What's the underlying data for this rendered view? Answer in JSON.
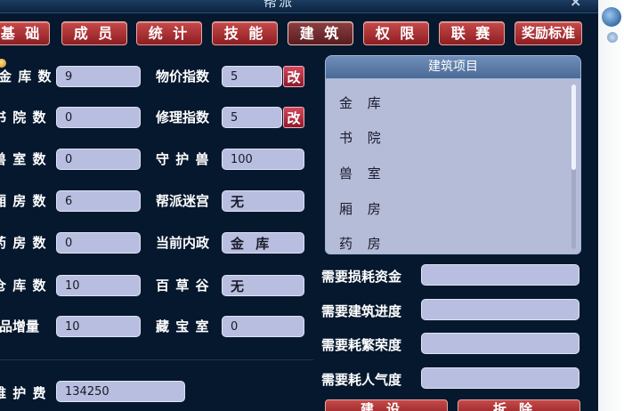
{
  "window": {
    "title": "帮派",
    "close": "×"
  },
  "tabs": [
    "基 础",
    "成 员",
    "统 计",
    "技 能",
    "建 筑",
    "权 限",
    "联 赛",
    "奖励标准"
  ],
  "left_col": [
    {
      "label": "金 库 数",
      "value": "9"
    },
    {
      "label": "书 院 数",
      "value": "0"
    },
    {
      "label": "兽 室 数",
      "value": "0"
    },
    {
      "label": "厢 房 数",
      "value": "6"
    },
    {
      "label": "药 房 数",
      "value": "0"
    },
    {
      "label": "仓 库 数",
      "value": "10"
    },
    {
      "label": "药品增量",
      "value": "10"
    }
  ],
  "mid_col": [
    {
      "label": "物价指数",
      "value": "5",
      "button": "改"
    },
    {
      "label": "修理指数",
      "value": "5",
      "button": "改"
    },
    {
      "label": "守 护 兽",
      "value": "100"
    },
    {
      "label": "帮派迷宫",
      "value": "无"
    },
    {
      "label": "当前内政",
      "value": "金 库"
    },
    {
      "label": "百 草 谷",
      "value": "无"
    },
    {
      "label": "藏 宝 室",
      "value": "0"
    }
  ],
  "maintenance": {
    "label": "维 护 费",
    "value": "134250"
  },
  "building_panel": {
    "title": "建筑项目",
    "items": [
      "金 库",
      "书 院",
      "兽 室",
      "厢 房",
      "药 房"
    ]
  },
  "requirements": [
    {
      "label": "需要损耗资金",
      "value": ""
    },
    {
      "label": "需要建筑进度",
      "value": ""
    },
    {
      "label": "需要耗繁荣度",
      "value": ""
    },
    {
      "label": "需要耗人气度",
      "value": ""
    }
  ],
  "buttons": {
    "build": "建设",
    "demolish": "拆除"
  }
}
